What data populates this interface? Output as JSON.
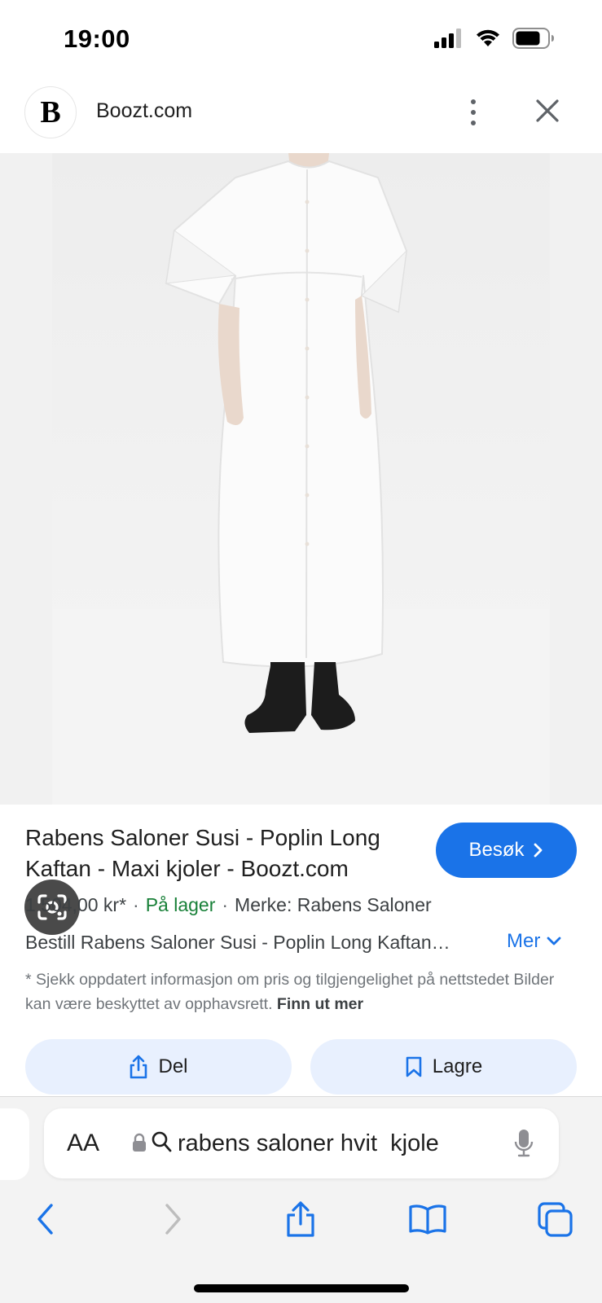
{
  "status_bar": {
    "time": "19:00",
    "signal_icon": "cellular-signal-icon",
    "wifi_icon": "wifi-icon",
    "battery_icon": "battery-icon"
  },
  "header": {
    "logo_letter": "B",
    "site_name": "Boozt.com",
    "more_icon": "more-vertical-icon",
    "close_icon": "close-icon"
  },
  "image": {
    "lens_icon": "google-lens-icon"
  },
  "result": {
    "title": "Rabens Saloner Susi - Poplin Long Kaftan - Maxi kjoler - Boozt.com",
    "visit_label": "Besøk",
    "price": "1 504,00 kr*",
    "stock": "På lager",
    "brand": "Merke: Rabens Saloner",
    "description": "Bestill Rabens Saloner Susi - Poplin Long Kaftan",
    "more_label": "Mer",
    "disclaimer": "* Sjekk oppdatert informasjon om pris og tilgjengelighet på nettstedet Bilder kan være beskyttet av opphavsrett.",
    "learn_more": "Finn ut mer",
    "colors": {
      "accent": "#1a73e8",
      "stock": "#188038",
      "pill_bg": "#e8f0fe"
    }
  },
  "actions": {
    "share_label": "Del",
    "save_label": "Lagre"
  },
  "safari": {
    "text_size_label": "AA",
    "address_value": "rabens saloner hvit  kjole"
  }
}
